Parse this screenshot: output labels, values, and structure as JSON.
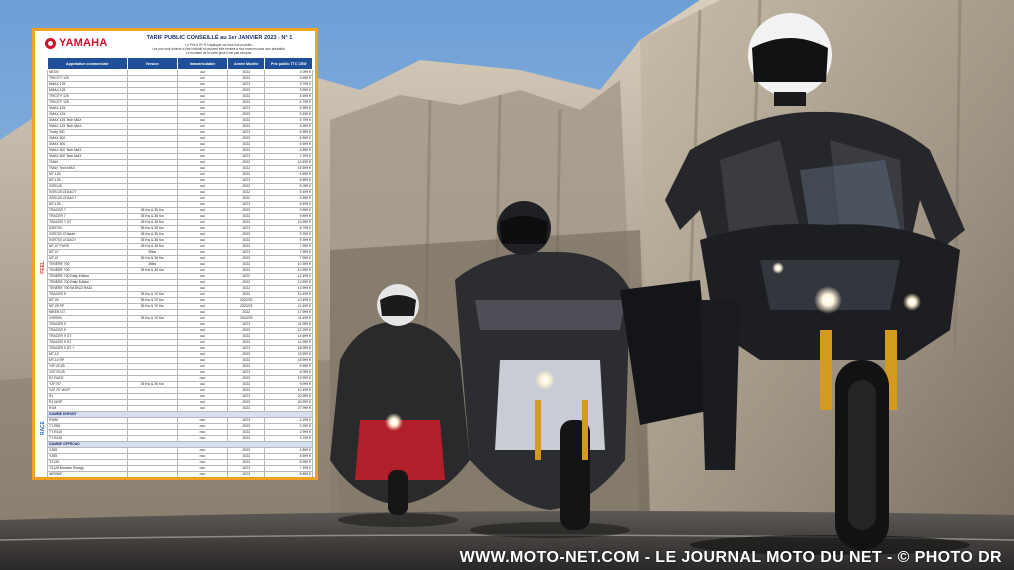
{
  "colors": {
    "sky": "#7fa8d6",
    "cliff": "#b3a89a",
    "road": "#3a3837",
    "frame": "#f0a21e",
    "header_blue": "#1f4f99",
    "yamaha_red": "#d2102b",
    "feel": "#c83a2e",
    "race": "#2b6fbf"
  },
  "pricelist": {
    "brand": "YAMAHA",
    "title": "TARIF PUBLIC CONSEILLÉ au 1er JANVIER 2023 - N° 1",
    "notes": [
      "Le Prix à 20 % s'applique sur tous nos produits.",
      "Les prix sont donnés à titre indicatif et peuvent être révisés à tout moment sans avis préalable.",
      "Le montant de la carte grise n'est pas compris."
    ],
    "columns": [
      "Appellation commerciale",
      "Version",
      "Immatriculable",
      "Année Modèle",
      "Prix public TTC CEM"
    ],
    "section_labels": [
      "FEEL",
      "RACE"
    ],
    "rows": [
      [
        "NEOS",
        "",
        "oui",
        "2023",
        "3 099 €"
      ],
      [
        "TRICITY 125",
        "",
        "oui",
        "2023",
        "3 699 €"
      ],
      [
        "NMAX 125",
        "",
        "oui",
        "2023",
        "3 799 €"
      ],
      [
        "NMAX 125",
        "",
        "oui",
        "2023",
        "3 999 €"
      ],
      [
        "TRICITY 125",
        "",
        "oui",
        "2023",
        "4 699 €"
      ],
      [
        "TRICITY 125",
        "",
        "oui",
        "2023",
        "4 799 €"
      ],
      [
        "XMAX 125",
        "",
        "oui",
        "2023",
        "5 399 €"
      ],
      [
        "XMAX 125",
        "",
        "oui",
        "2023",
        "5 499 €"
      ],
      [
        "XMAX 125 Tech MAX",
        "",
        "oui",
        "2023",
        "5 799 €"
      ],
      [
        "XMAX 125 Tech MAX",
        "",
        "oui",
        "2023",
        "5 999 €"
      ],
      [
        "Tricity 300",
        "",
        "oui",
        "2023",
        "6 999 €"
      ],
      [
        "XMAX 300",
        "",
        "oui",
        "2023",
        "6 599 €"
      ],
      [
        "XMAX 300",
        "",
        "oui",
        "2023",
        "6 699 €"
      ],
      [
        "XMAX 300 Tech MAX",
        "",
        "oui",
        "2023",
        "6 899 €"
      ],
      [
        "XMAX 300 Tech MAX",
        "",
        "oui",
        "2023",
        "7 299 €"
      ],
      [
        "TMAX",
        "",
        "oui",
        "2022",
        "13 499 €"
      ],
      [
        "TMAX Tech MAX",
        "",
        "oui",
        "2022",
        "15 599 €"
      ],
      [
        "MT-125",
        "",
        "oui",
        "2023",
        "5 599 €"
      ],
      [
        "MT-125",
        "",
        "oui",
        "2023",
        "5 699 €"
      ],
      [
        "XSR125",
        "",
        "oui",
        "2022",
        "5 099 €"
      ],
      [
        "XSR125 LEGACY",
        "",
        "oui",
        "2022",
        "5 499 €"
      ],
      [
        "XSR125 LEGACY",
        "",
        "oui",
        "2022",
        "5 599 €"
      ],
      [
        "MT-125",
        "",
        "oui",
        "2023",
        "6 499 €"
      ],
      [
        "TRACER 7",
        "35 Kw & 35 Kw",
        "oui",
        "2023",
        "9 599 €"
      ],
      [
        "TRACER 7",
        "35 Kw & 35 Kw",
        "oui",
        "2023",
        "9 899 €"
      ],
      [
        "TRACER 7 GT",
        "35 Kw & 35 Kw",
        "oui",
        "2023",
        "10 999 €"
      ],
      [
        "XSR700",
        "35 Kw & 35 Kw",
        "oui",
        "2023",
        "8 799 €"
      ],
      [
        "XSR700 XTribute",
        "35 Kw & 35 Kw",
        "oui",
        "2023",
        "9 299 €"
      ],
      [
        "XSR700 LEGACY",
        "35 Kw & 35 Kw",
        "oui",
        "2023",
        "9 399 €"
      ],
      [
        "MT-07 PURE",
        "35 Kw & 35 Kw",
        "oui",
        "2023",
        "7 599 €"
      ],
      [
        "MT-07",
        "35kw",
        "oui",
        "2023",
        "7 599 €"
      ],
      [
        "MT-07",
        "35 Kw & 35 Kw",
        "oui",
        "2023",
        "7 999 €"
      ],
      [
        "TÉNÉRÉ 700",
        "35kw",
        "oui",
        "2023",
        "10 399 €"
      ],
      [
        "TÉNÉRÉ 700",
        "35 Kw & 35 Kw",
        "oui",
        "2023",
        "10 999 €"
      ],
      [
        "TÉNÉRÉ 700 Rally Edition",
        "",
        "oui",
        "2022",
        "12 499 €"
      ],
      [
        "TÉNÉRÉ 700 Rally Edition",
        "",
        "oui",
        "2022",
        "12 899 €"
      ],
      [
        "TÉNÉRÉ 700 WORLD RAID",
        "",
        "oui",
        "2022",
        "13 999 €"
      ],
      [
        "TRACER 9",
        "35 Kw & 70 Kw",
        "oui",
        "2023",
        "13 499 €"
      ],
      [
        "MT-09",
        "35 Kw & 70 Kw",
        "oui",
        "2022/23",
        "10 499 €"
      ],
      [
        "MT-09 SP",
        "35 Kw & 70 Kw",
        "oui",
        "2022/23",
        "12 499 €"
      ],
      [
        "NIKEN GT",
        "",
        "oui",
        "2022",
        "17 999 €"
      ],
      [
        "XSR900",
        "35 Kw & 70 Kw",
        "oui",
        "2022/23",
        "11 499 €"
      ],
      [
        "TRACER 9",
        "",
        "oui",
        "2023",
        "11 999 €"
      ],
      [
        "TRACER 9",
        "",
        "oui",
        "2023",
        "12 299 €"
      ],
      [
        "TRACER 9 GT",
        "",
        "oui",
        "2023",
        "14 699 €"
      ],
      [
        "TRACER 9 GT",
        "",
        "oui",
        "2023",
        "14 999 €"
      ],
      [
        "TRACER 9 GT +",
        "",
        "oui",
        "2023",
        "18 999 €"
      ],
      [
        "MT-10",
        "",
        "oui",
        "2023",
        "15 999 €"
      ],
      [
        "MT-10 SP",
        "",
        "oui",
        "2023",
        "18 999 €"
      ],
      [
        "YZF-R125",
        "",
        "oui",
        "2023",
        "5 999 €"
      ],
      [
        "YZF-R125",
        "",
        "oui",
        "2023",
        "6 099 €"
      ],
      [
        "R1 RACE",
        "",
        "non",
        "2023",
        "19 999 €"
      ],
      [
        "YZF-R7",
        "35 Kw & 35 Kw",
        "oui",
        "2023",
        "9 999 €"
      ],
      [
        "YZF-R7 WGP",
        "",
        "oui",
        "2023",
        "10 499 €"
      ],
      [
        "R1",
        "",
        "oui",
        "2023",
        "20 999 €"
      ],
      [
        "R1 WGP",
        "",
        "oui",
        "2023",
        "20 999 €"
      ],
      [
        "R1M",
        "",
        "oui",
        "2023",
        "27 999 €"
      ]
    ],
    "section_enfant": "GAMME ENFANT",
    "rows_enfant": [
      [
        "PW50",
        "",
        "non",
        "2023",
        "2 199 €"
      ],
      [
        "TT-R50",
        "",
        "non",
        "2023",
        "2 299 €"
      ],
      [
        "TT-R110",
        "",
        "non",
        "2023",
        "2 999 €"
      ],
      [
        "TT-R125",
        "",
        "non",
        "2023",
        "3 799 €"
      ]
    ],
    "section_offroad": "GAMME OFFROAD",
    "rows_offroad": [
      [
        "YZ65",
        "",
        "non",
        "2023",
        "4 899 €"
      ],
      [
        "YZ85",
        "",
        "non",
        "2023",
        "5 599 €"
      ],
      [
        "YZ125",
        "",
        "non",
        "2023",
        "6 999 €"
      ],
      [
        "YZ125 Monster Energy",
        "",
        "non",
        "2023",
        "7 199 €"
      ],
      [
        "WR250F",
        "",
        "non",
        "2023",
        "8 899 €"
      ],
      [
        "YZ250",
        "",
        "non",
        "2023",
        "8 999 €"
      ],
      [
        "YZ250F 2022",
        "",
        "non",
        "2022",
        "9 399 €"
      ],
      [
        "YZ250F Monster Energy",
        "",
        "non",
        "2023",
        "9 899 €"
      ],
      [
        "WR450F",
        "",
        "non",
        "2023",
        "9 999 €"
      ],
      [
        "YZ450F",
        "",
        "non",
        "2023",
        "10 899 €"
      ],
      [
        "YZ450F Monster Energy",
        "",
        "non",
        "2023",
        "11 699 €"
      ]
    ]
  },
  "watermark": "WWW.MOTO-NET.COM - LE JOURNAL MOTO DU NET - © PHOTO DR"
}
